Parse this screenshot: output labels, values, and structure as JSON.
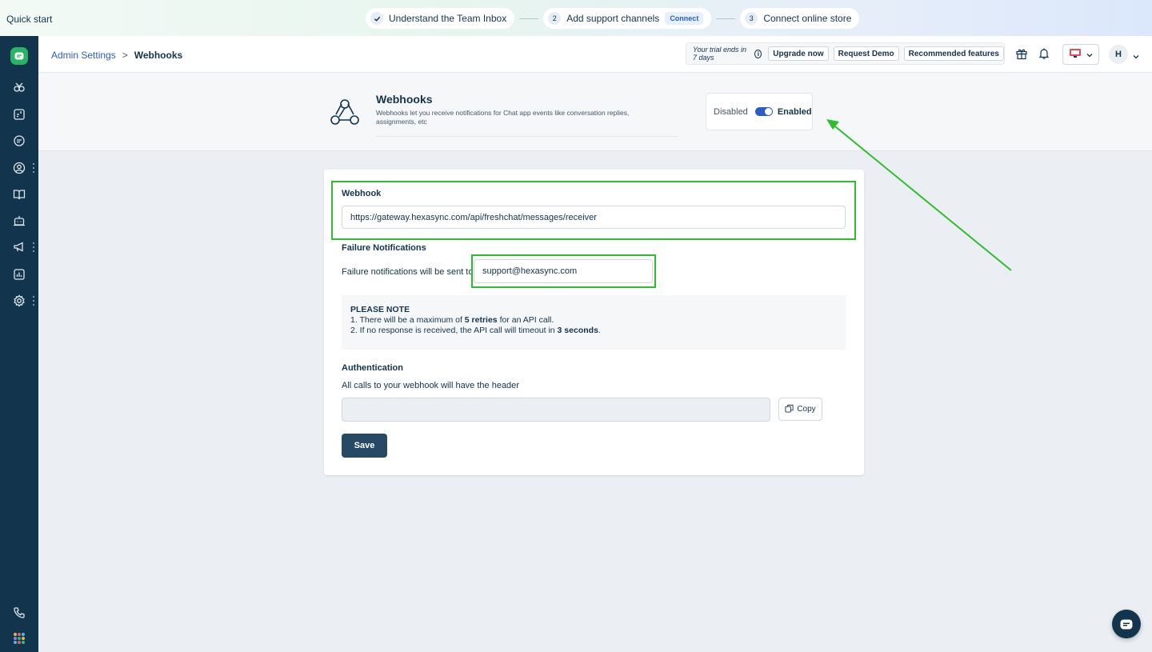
{
  "quickstart": {
    "label": "Quick start",
    "steps": [
      {
        "num": "",
        "label": "Understand the Team Inbox",
        "done": true
      },
      {
        "num": "2",
        "label": "Add support channels",
        "badge": "Connect"
      },
      {
        "num": "3",
        "label": "Connect online store"
      }
    ]
  },
  "header": {
    "breadcrumb": {
      "parent": "Admin Settings",
      "separator": ">",
      "current": "Webhooks"
    },
    "trial_text": "Your trial ends in 7 days",
    "upgrade_label": "Upgrade now",
    "demo_label": "Request Demo",
    "features_label": "Recommended features",
    "avatar_initial": "H"
  },
  "page": {
    "title": "Webhooks",
    "description": "Webhooks let you receive notifications for Chat app events like conversation replies, assignments, etc",
    "toggle": {
      "off_label": "Disabled",
      "on_label": "Enabled",
      "state": "enabled"
    }
  },
  "form": {
    "webhook_label": "Webhook",
    "webhook_url": "https://gateway.hexasync.com/api/freshchat/messages/receiver",
    "failure_title": "Failure Notifications",
    "failure_text": "Failure notifications will be sent to",
    "failure_email": "support@hexasync.com",
    "note": {
      "title": "PLEASE NOTE",
      "line1_pre": "1. There will be a maximum of ",
      "line1_bold": "5 retries",
      "line1_post": " for an API call.",
      "line2_pre": "2. If no response is received, the API call will timeout in ",
      "line2_bold": "3 seconds",
      "line2_post": "."
    },
    "auth_title": "Authentication",
    "auth_text": "All calls to your webhook will have the header",
    "auth_value": "",
    "copy_label": "Copy",
    "save_label": "Save"
  },
  "colors": {
    "nav_bg": "#12344d",
    "accent": "#2c5cc5",
    "brand_green": "#28b463",
    "highlight": "#2dbd2d",
    "save_bg": "#264966"
  },
  "icons": [
    "check-icon",
    "chat-logo-icon",
    "omni-icon",
    "inbox-icon",
    "conversation-icon",
    "contacts-icon",
    "knowledge-base-icon",
    "bot-icon",
    "campaigns-icon",
    "reports-icon",
    "settings-icon",
    "phone-icon",
    "apps-grid-icon",
    "gift-icon",
    "bell-icon",
    "device-icon",
    "chevron-down-icon",
    "webhook-icon",
    "copy-icon",
    "chat-widget-icon"
  ]
}
